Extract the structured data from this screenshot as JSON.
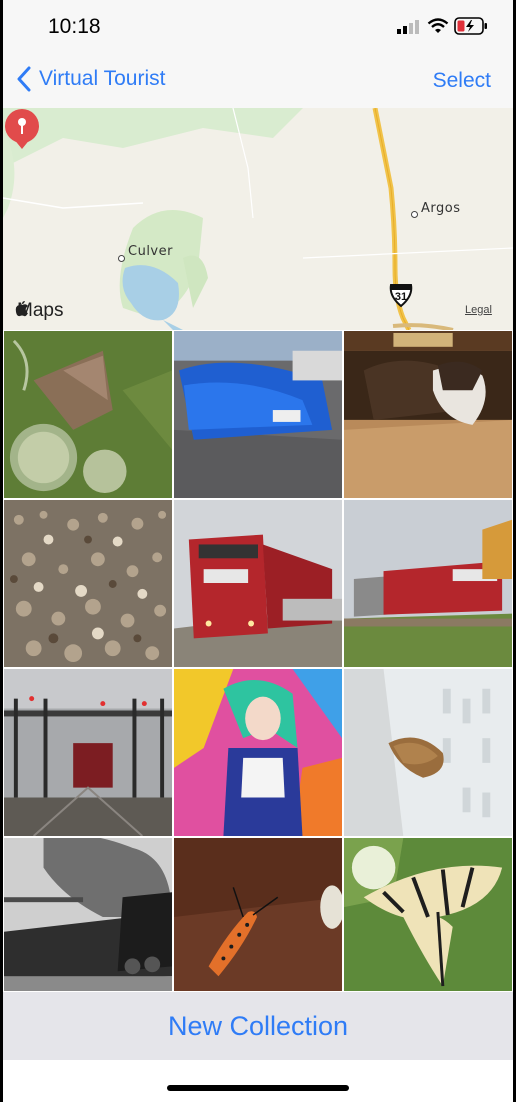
{
  "status_bar": {
    "time": "10:18"
  },
  "nav": {
    "back_label": "Virtual Tourist",
    "select_label": "Select"
  },
  "map": {
    "towns": [
      "Culver",
      "Argos"
    ],
    "route_shield": "31",
    "maps_label": "Maps",
    "legal_label": "Legal"
  },
  "photos": [
    {
      "subject": "moth on thistle"
    },
    {
      "subject": "blue sports car"
    },
    {
      "subject": "dog under table"
    },
    {
      "subject": "gravel pebbles"
    },
    {
      "subject": "CP locomotive front"
    },
    {
      "subject": "CP locomotives train"
    },
    {
      "subject": "rail yard signals"
    },
    {
      "subject": "comic art portrait"
    },
    {
      "subject": "moth on siding"
    },
    {
      "subject": "steam locomotive bw"
    },
    {
      "subject": "red moth insect"
    },
    {
      "subject": "swallowtail butterfly"
    }
  ],
  "footer": {
    "new_collection_label": "New Collection"
  },
  "colors": {
    "accent": "#2f7cf6",
    "pin": "#e14b4b"
  }
}
